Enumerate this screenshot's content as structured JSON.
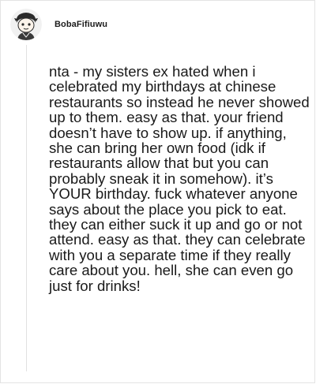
{
  "post": {
    "username": "BobaFifiuwu",
    "avatar_icon": "cartoon-character-avatar-icon",
    "body": "nta - my sisters ex hated when i celebrated my birthdays at chinese restaurants so instead he never showed up to them. easy as that. your friend doesn’t have to show up. if anything, she can bring her own food (idk if restaurants allow that but you can probably sneak it in somehow). it’s YOUR birthday. fuck whatever anyone says about the place you pick to eat. they can either suck it up and go or not attend. easy as that. they can celebrate with you a separate time if they really care about you. hell, she can even go just for drinks!"
  }
}
